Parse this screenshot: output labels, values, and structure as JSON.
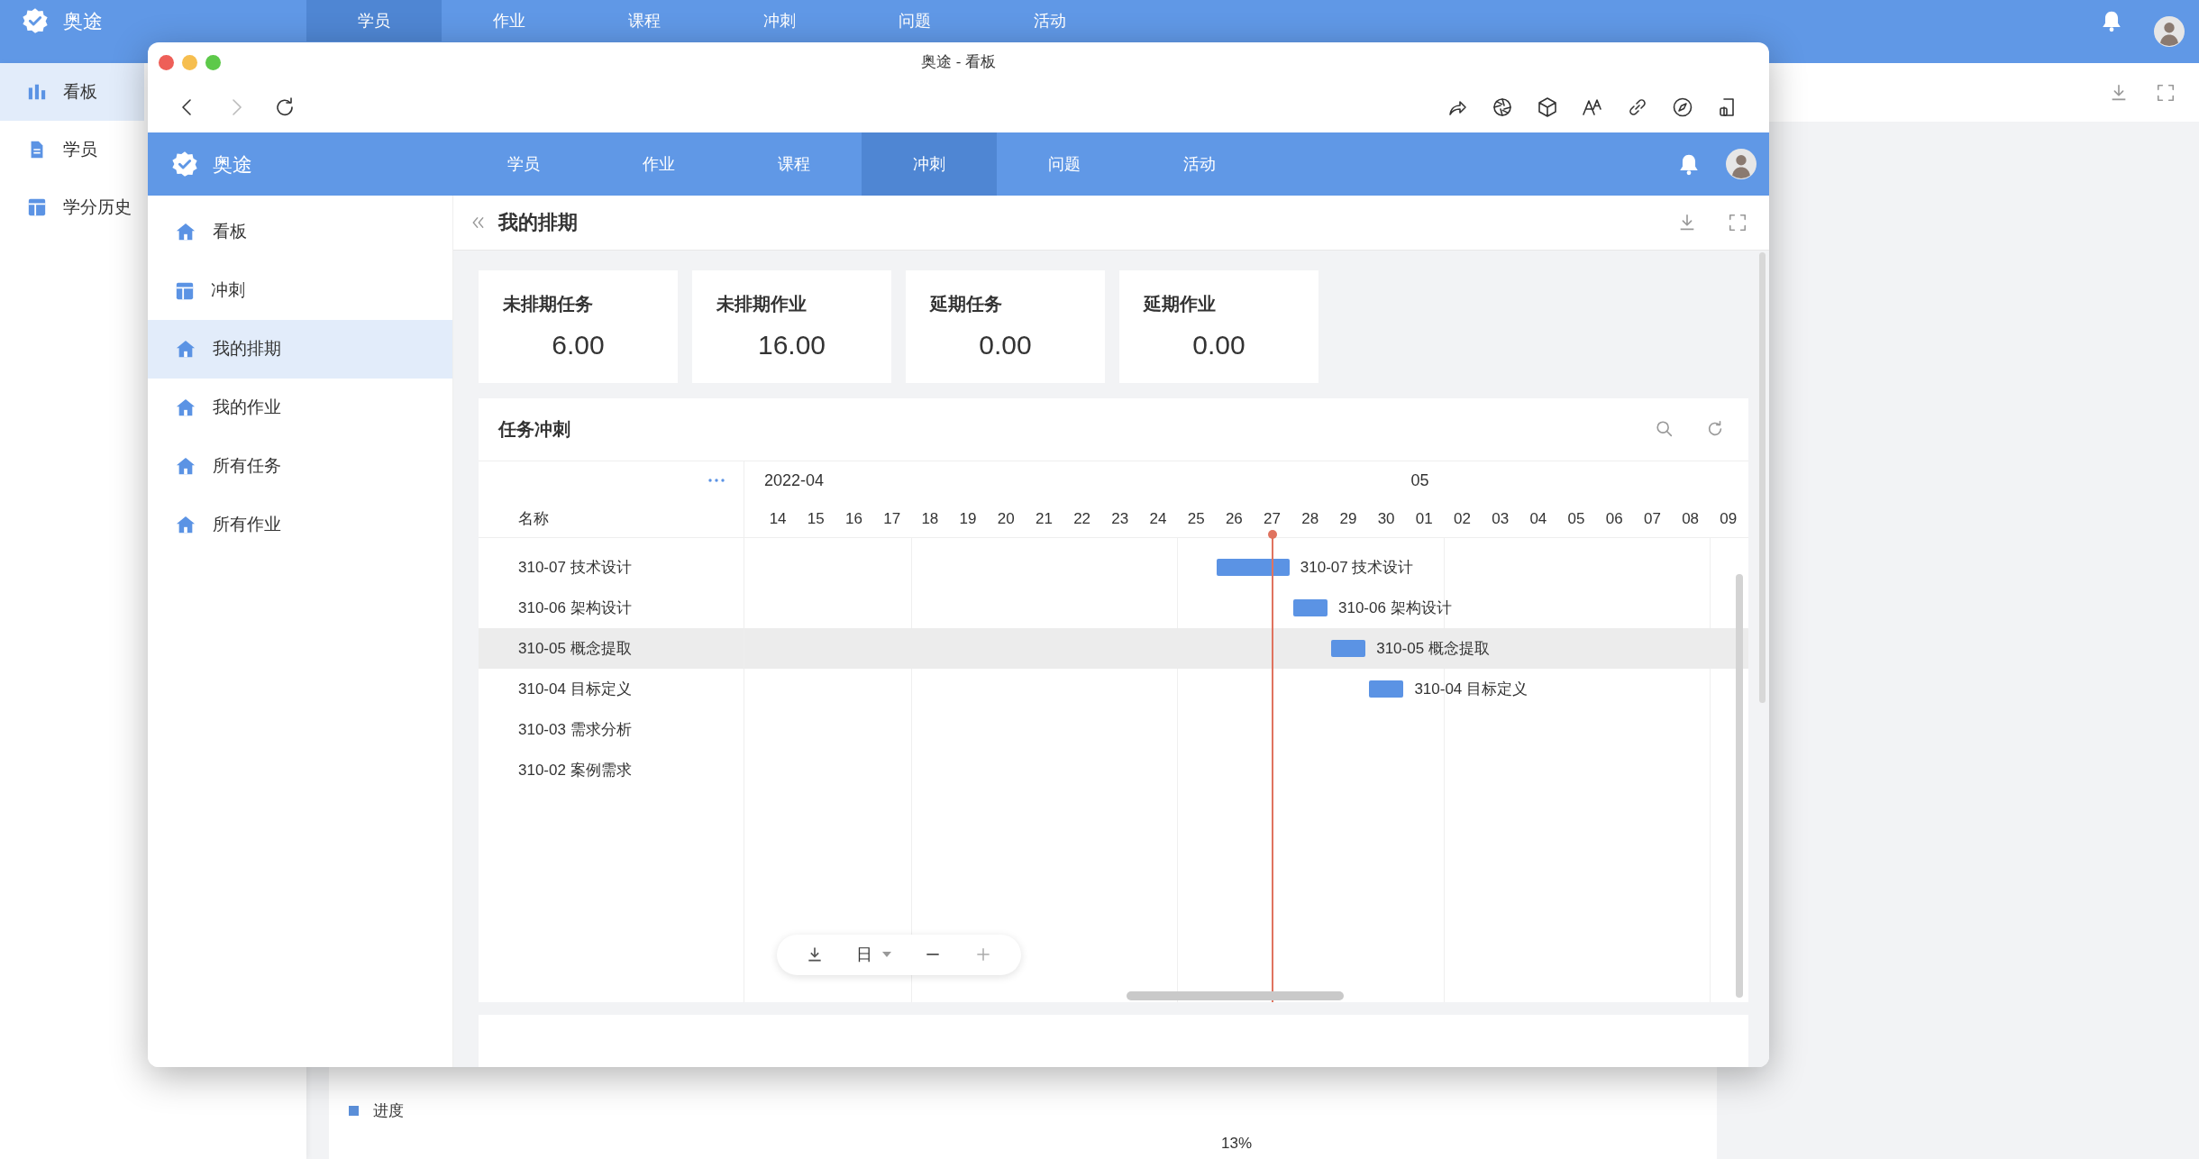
{
  "background_app": {
    "logo": "奥途",
    "nav": [
      {
        "label": "学员",
        "selected": true
      },
      {
        "label": "作业",
        "selected": false
      },
      {
        "label": "课程",
        "selected": false
      },
      {
        "label": "冲刺",
        "selected": false
      },
      {
        "label": "问题",
        "selected": false
      },
      {
        "label": "活动",
        "selected": false
      }
    ],
    "sidebar": [
      {
        "label": "看板",
        "kind": "chart",
        "selected": true
      },
      {
        "label": "学员",
        "kind": "doc",
        "selected": false
      },
      {
        "label": "学分历史",
        "kind": "table",
        "selected": false
      }
    ],
    "legend": {
      "label": "进度",
      "color": "#5b8fd9"
    },
    "percent": "13%"
  },
  "window": {
    "title": "奥途 - 看板"
  },
  "app": {
    "logo": "奥途",
    "nav": [
      {
        "label": "学员",
        "selected": false
      },
      {
        "label": "作业",
        "selected": false
      },
      {
        "label": "课程",
        "selected": false
      },
      {
        "label": "冲刺",
        "selected": true
      },
      {
        "label": "问题",
        "selected": false
      },
      {
        "label": "活动",
        "selected": false
      }
    ],
    "sidebar": [
      {
        "label": "看板",
        "kind": "house",
        "selected": false
      },
      {
        "label": "冲刺",
        "kind": "table",
        "selected": false
      },
      {
        "label": "我的排期",
        "kind": "house",
        "selected": true
      },
      {
        "label": "我的作业",
        "kind": "house",
        "selected": false
      },
      {
        "label": "所有任务",
        "kind": "house",
        "selected": false
      },
      {
        "label": "所有作业",
        "kind": "house",
        "selected": false
      }
    ]
  },
  "page": {
    "title": "我的排期"
  },
  "stats": [
    {
      "label": "未排期任务",
      "value": "6.00"
    },
    {
      "label": "未排期作业",
      "value": "16.00"
    },
    {
      "label": "延期任务",
      "value": "0.00"
    },
    {
      "label": "延期作业",
      "value": "0.00"
    }
  ],
  "gantt": {
    "title": "任务冲刺",
    "column_header": "名称",
    "months": [
      "2022-04",
      "05"
    ],
    "days": [
      "14",
      "15",
      "16",
      "17",
      "18",
      "19",
      "20",
      "21",
      "22",
      "23",
      "24",
      "25",
      "26",
      "27",
      "28",
      "29",
      "30",
      "01",
      "02",
      "03",
      "04",
      "05",
      "06",
      "07",
      "08",
      "09"
    ],
    "tasks": [
      {
        "name": "310-07 技术设计",
        "hovered": false,
        "bar": {
          "label": "310-07 技术设计"
        }
      },
      {
        "name": "310-06 架构设计",
        "hovered": false,
        "bar": {
          "label": "310-06 架构设计"
        }
      },
      {
        "name": "310-05 概念提取",
        "hovered": true,
        "bar": {
          "label": "310-05 概念提取"
        }
      },
      {
        "name": "310-04 目标定义",
        "hovered": false,
        "bar": {
          "label": "310-04 目标定义"
        }
      },
      {
        "name": "310-03 需求分析",
        "hovered": false
      },
      {
        "name": "310-02 案例需求",
        "hovered": false
      }
    ],
    "scale": "日"
  }
}
